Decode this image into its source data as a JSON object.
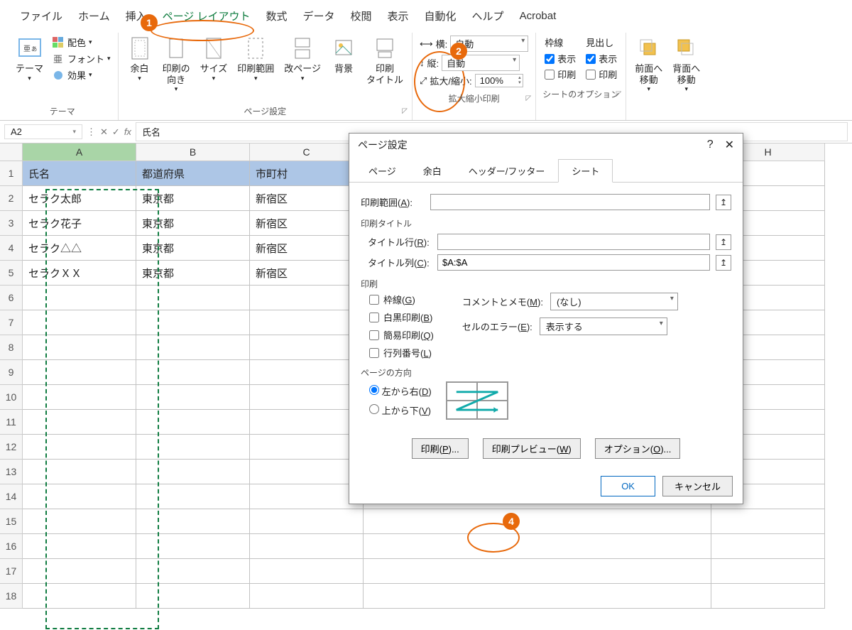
{
  "menu": {
    "file": "ファイル",
    "home": "ホーム",
    "insert": "挿入",
    "pageLayout": "ページ レイアウト",
    "formulas": "数式",
    "data": "データ",
    "review": "校閲",
    "view": "表示",
    "automate": "自動化",
    "help": "ヘルプ",
    "acrobat": "Acrobat"
  },
  "ribbon": {
    "themes": {
      "label": "テーマ",
      "theme": "テーマ",
      "colors": "配色",
      "fonts": "フォント",
      "effects": "効果"
    },
    "pageSetup": {
      "label": "ページ設定",
      "margins": "余白",
      "orientation": "印刷の\n向き",
      "size": "サイズ",
      "printArea": "印刷範囲",
      "breaks": "改ページ",
      "background": "背景",
      "printTitles": "印刷\nタイトル"
    },
    "scaleToFit": {
      "label": "拡大縮小印刷",
      "widthLabel": "横:",
      "heightLabel": "縦:",
      "scaleLabel": "拡大/縮小:",
      "auto": "自動",
      "scaleValue": "100%"
    },
    "sheetOptions": {
      "label": "シートのオプション",
      "gridlines": "枠線",
      "headings": "見出し",
      "view": "表示",
      "print": "印刷"
    },
    "arrange": {
      "front": "前面へ\n移動",
      "back": "背面へ\n移動"
    }
  },
  "nameBox": "A2",
  "formula": "氏名",
  "columns": [
    "A",
    "B",
    "C",
    "",
    "",
    "",
    "H"
  ],
  "rows": [
    "1",
    "2",
    "3",
    "4",
    "5",
    "6",
    "7",
    "8",
    "9",
    "10",
    "11",
    "12",
    "13",
    "14",
    "15",
    "16",
    "17",
    "18"
  ],
  "gridData": [
    [
      "氏名",
      "都道府県",
      "市町村"
    ],
    [
      "セラク太郎",
      "東京都",
      "新宿区"
    ],
    [
      "セラク花子",
      "東京都",
      "新宿区"
    ],
    [
      "セラク△△",
      "東京都",
      "新宿区"
    ],
    [
      "セラクＸＸ",
      "東京都",
      "新宿区"
    ]
  ],
  "dialog": {
    "title": "ページ設定",
    "tabs": {
      "page": "ページ",
      "margins": "余白",
      "headerFooter": "ヘッダー/フッター",
      "sheet": "シート"
    },
    "printAreaLabel": "印刷範囲(",
    "printAreaKey": "A",
    "printAreaClose": "):",
    "printTitles": "印刷タイトル",
    "titleRowsLabel": "タイトル行(",
    "titleRowsKey": "R",
    "titleRowsClose": "):",
    "titleColsLabel": "タイトル列(",
    "titleColsKey": "C",
    "titleColsClose": "):",
    "titleColsValue": "$A:$A",
    "printSection": "印刷",
    "gridlines": "枠線(",
    "gridlinesKey": "G",
    "gridlinesClose": ")",
    "blackWhite": "白黒印刷(",
    "blackWhiteKey": "B",
    "blackWhiteClose": ")",
    "draft": "簡易印刷(",
    "draftKey": "Q",
    "draftClose": ")",
    "rowColHeaders": "行列番号(",
    "rowColHeadersKey": "L",
    "rowColHeadersClose": ")",
    "commentsLabel": "コメントとメモ(",
    "commentsKey": "M",
    "commentsClose": "):",
    "commentsValue": "(なし)",
    "errorsLabel": "セルのエラー(",
    "errorsKey": "E",
    "errorsClose": "):",
    "errorsValue": "表示する",
    "pageOrder": "ページの方向",
    "leftToRight": "左から右(",
    "leftToRightKey": "D",
    "leftToRightClose": ")",
    "topToBottom": "上から下(",
    "topToBottomKey": "V",
    "topToBottomClose": ")",
    "printBtn": "印刷(",
    "printBtnKey": "P",
    "printBtnClose": ")...",
    "previewBtn": "印刷プレビュー(",
    "previewBtnKey": "W",
    "previewBtnClose": ")",
    "optionsBtn": "オプション(",
    "optionsBtnKey": "O",
    "optionsBtnClose": ")...",
    "ok": "OK",
    "cancel": "キャンセル"
  }
}
